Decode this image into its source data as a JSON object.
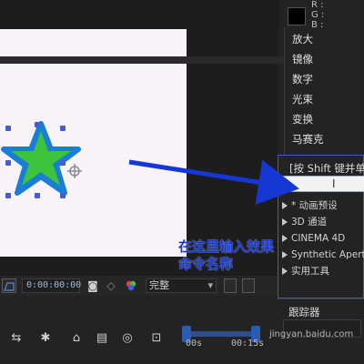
{
  "info_panel": {
    "channels": [
      "R :",
      "G :",
      "B :"
    ],
    "swatch_color": "#000000"
  },
  "effects_menu": {
    "items": [
      "放大",
      "镜像",
      "数字",
      "光束",
      "变换",
      "马赛克"
    ]
  },
  "effects_presets": {
    "hint": "[按 Shift 键并单",
    "search_value": "",
    "categories": [
      "* 动画预设",
      "3D 通道",
      "CINEMA 4D",
      "Synthetic Apertu",
      "实用工具"
    ]
  },
  "viewer": {
    "timecode": "0:00:00:00",
    "quality": "完整"
  },
  "timeline": {
    "ruler_start": "00s",
    "ruler_mark": "00:15s"
  },
  "bottom_panel": {
    "tab_label": "跟踪器"
  },
  "annotation": {
    "line1": "在这里输入效果",
    "line2": "命令名称",
    "color": "#1437d6"
  },
  "watermark": "jingyan.baidu.com"
}
